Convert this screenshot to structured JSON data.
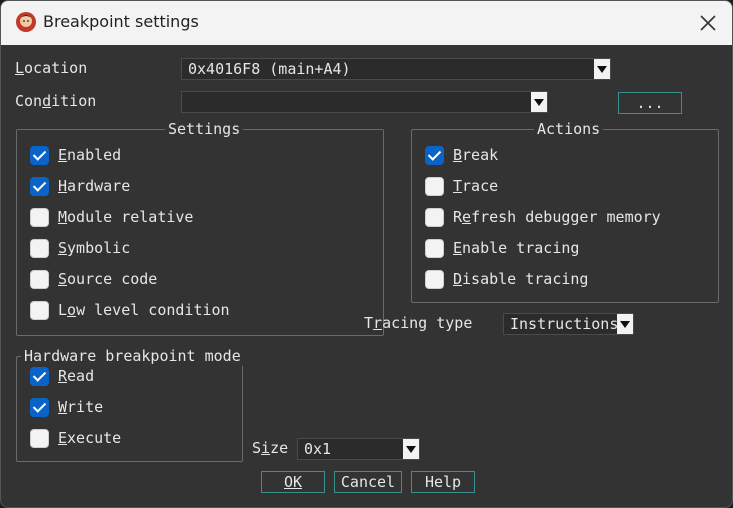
{
  "window": {
    "title": "Breakpoint settings",
    "icon": "app-avatar-icon"
  },
  "location": {
    "label": "Location",
    "mnemonic": "L",
    "value": "0x4016F8 (main+A4)"
  },
  "condition": {
    "label": "Condition",
    "mnemonic": "d",
    "value": "",
    "browse_label": "..."
  },
  "settings": {
    "title": "Settings",
    "items": [
      {
        "label": "Enabled",
        "mnemonic": "E",
        "checked": true
      },
      {
        "label": "Hardware",
        "mnemonic": "H",
        "checked": true
      },
      {
        "label": "Module relative",
        "mnemonic": "M",
        "checked": false
      },
      {
        "label": "Symbolic",
        "mnemonic": "S",
        "checked": false
      },
      {
        "label": "Source code",
        "mnemonic": "S",
        "checked": false
      },
      {
        "label": "Low level condition",
        "mnemonic": "o",
        "checked": false
      }
    ]
  },
  "actions": {
    "title": "Actions",
    "items": [
      {
        "label": "Break",
        "mnemonic": "B",
        "checked": true
      },
      {
        "label": "Trace",
        "mnemonic": "T",
        "checked": false
      },
      {
        "label": "Refresh debugger memory",
        "mnemonic": "e",
        "checked": false
      },
      {
        "label": "Enable tracing",
        "mnemonic": "E",
        "checked": false
      },
      {
        "label": "Disable tracing",
        "mnemonic": "D",
        "checked": false
      }
    ]
  },
  "tracing_type": {
    "label": "Tracing type",
    "mnemonic": "r",
    "value": "Instructions"
  },
  "hw_mode": {
    "title": "Hardware breakpoint mode",
    "items": [
      {
        "label": "Read",
        "mnemonic": "R",
        "checked": true
      },
      {
        "label": "Write",
        "mnemonic": "W",
        "checked": true
      },
      {
        "label": "Execute",
        "mnemonic": "E",
        "checked": false
      }
    ]
  },
  "size": {
    "label": "Size",
    "mnemonic": "i",
    "value": "0x1"
  },
  "buttons": {
    "ok": "OK",
    "cancel": "Cancel",
    "help": "Help"
  },
  "colors": {
    "accent": "#0a64c8",
    "button_border": "#3a8f8f",
    "background": "#333333"
  }
}
